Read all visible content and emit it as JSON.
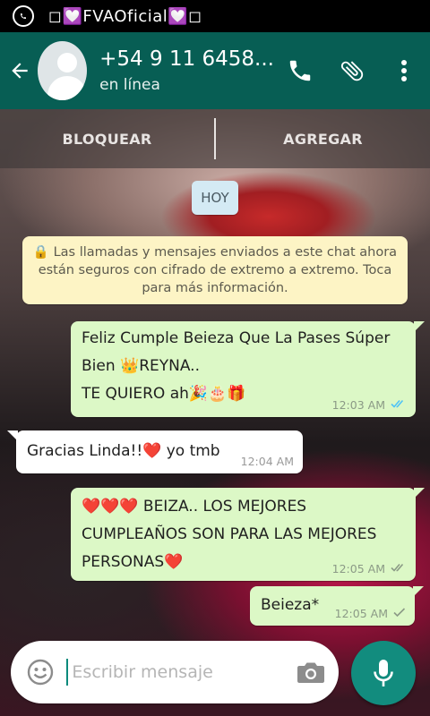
{
  "status_bar": {
    "title": "◻💟FVAOficial💟◻",
    "app_icon": "whatsapp-icon"
  },
  "header": {
    "contact_name": "+54 9 11 6458...",
    "status": "en línea",
    "icons": [
      "back-arrow-icon",
      "phone-icon",
      "attach-icon",
      "more-vert-icon"
    ]
  },
  "actions": {
    "block_label": "BLOQUEAR",
    "add_label": "AGREGAR"
  },
  "date_chip": "HOY",
  "security_note": "🔒 Las llamadas y mensajes enviados a este chat ahora están seguros con cifrado de extremo a extremo. Toca para más información.",
  "messages": [
    {
      "direction": "out",
      "lines": [
        "Feliz Cumple Beieza Que La Pases Súper",
        "Bien 👑REYNA..",
        "TE QUIERO ah🎉🎂🎁"
      ],
      "time": "12:03 AM",
      "status": "read"
    },
    {
      "direction": "in",
      "lines": [
        "Gracias Linda!!❤️  yo tmb"
      ],
      "time": "12:04 AM"
    },
    {
      "direction": "out",
      "lines": [
        "❤️❤️❤️  BEIZA.. LOS MEJORES",
        "CUMPLEAÑOS SON PARA LAS MEJORES",
        "PERSONAS❤️"
      ],
      "time": "12:05 AM",
      "status": "delivered"
    },
    {
      "direction": "out",
      "lines": [
        "Beieza*"
      ],
      "time": "12:05 AM",
      "status": "sent"
    }
  ],
  "composer": {
    "placeholder": "Escribir mensaje",
    "value": ""
  },
  "colors": {
    "header": "#075e54",
    "outgoing_bubble": "#dcf8c6",
    "incoming_bubble": "#ffffff",
    "read_ticks": "#4fc3f7",
    "mic_button": "#128c7e"
  }
}
